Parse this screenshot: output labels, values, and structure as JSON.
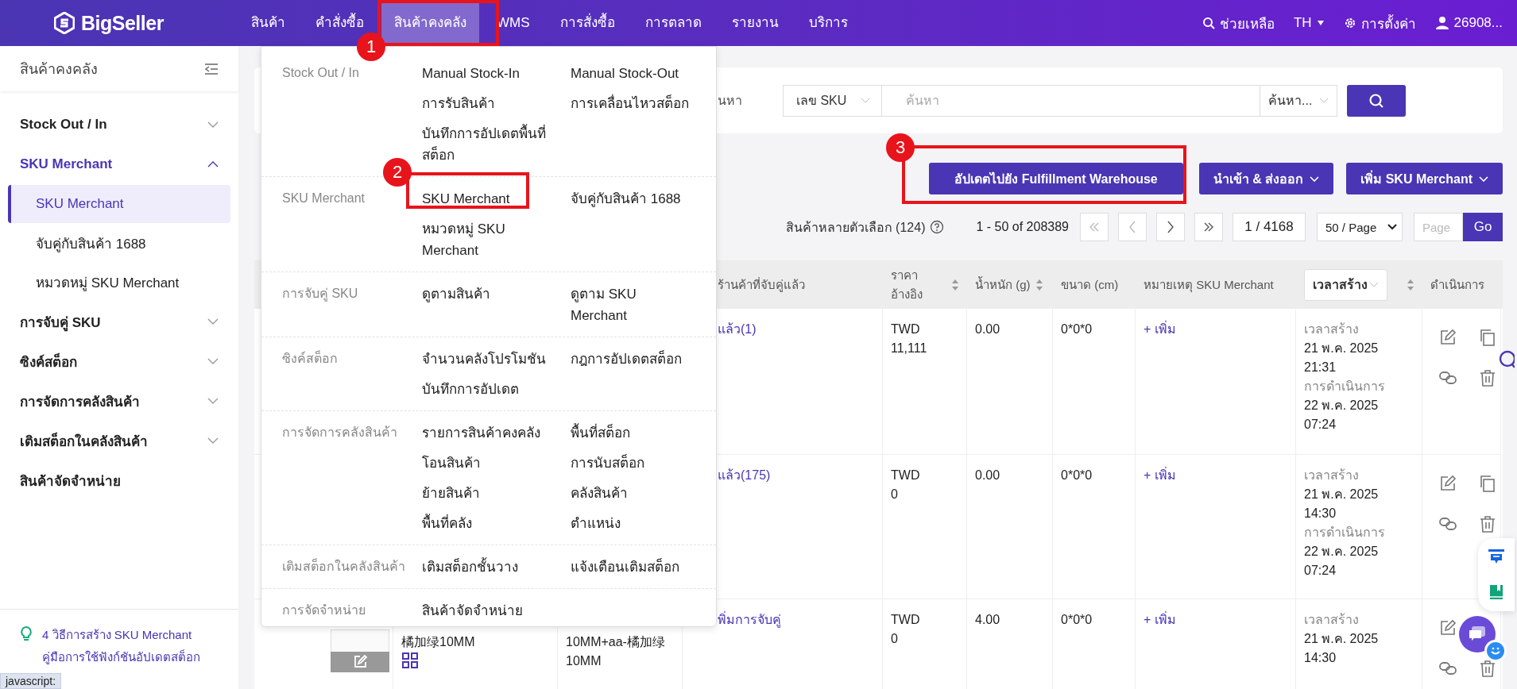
{
  "topbar": {
    "logo": "BigSeller",
    "nav": [
      {
        "label": "สินค้า",
        "selected": false
      },
      {
        "label": "คำสั่งซื้อ",
        "selected": false
      },
      {
        "label": "สินค้าคงคลัง",
        "selected": true
      },
      {
        "label": "WMS",
        "selected": false
      },
      {
        "label": "การสั่งซื้อ",
        "selected": false
      },
      {
        "label": "การตลาด",
        "selected": false
      },
      {
        "label": "รายงาน",
        "selected": false
      },
      {
        "label": "บริการ",
        "selected": false
      }
    ],
    "help": "ช่วยเหลือ",
    "language": "TH",
    "settings": "การตั้งค่า",
    "user": "26908..."
  },
  "sidebar": {
    "title": "สินค้าคงคลัง",
    "items": [
      {
        "label": "Stock Out / In",
        "expandable": true,
        "expanded": false
      },
      {
        "label": "SKU Merchant",
        "expandable": true,
        "expanded": true,
        "children": [
          {
            "label": "SKU Merchant",
            "selected": true
          },
          {
            "label": "จับคู่กับสินค้า 1688",
            "selected": false
          },
          {
            "label": "หมวดหมู่ SKU Merchant",
            "selected": false
          }
        ]
      },
      {
        "label": "การจับคู่ SKU",
        "expandable": true,
        "expanded": false
      },
      {
        "label": "ซิงค์สต็อก",
        "expandable": true,
        "expanded": false
      },
      {
        "label": "การจัดการคลังสินค้า",
        "expandable": true,
        "expanded": false
      },
      {
        "label": "เติมสต็อกในคลังสินค้า",
        "expandable": true,
        "expanded": false
      },
      {
        "label": "สินค้าจัดจำหน่าย",
        "expandable": false,
        "expanded": false
      }
    ],
    "tips": [
      "4 วิธีการสร้าง SKU Merchant",
      "คู่มือการใช้ฟังก์ชันอัปเดตสต็อก"
    ]
  },
  "dropdown": {
    "sections": [
      {
        "label": "Stock Out / In",
        "items": [
          "Manual Stock-In",
          "Manual Stock-Out",
          "การรับสินค้า",
          "การเคลื่อนไหวสต็อก",
          "บันทึกการอัปเดตพื้นที่สต็อก"
        ]
      },
      {
        "label": "SKU Merchant",
        "items": [
          "SKU Merchant",
          "จับคู่กับสินค้า 1688",
          "หมวดหมู่ SKU Merchant"
        ]
      },
      {
        "label": "การจับคู่ SKU",
        "items": [
          "ดูตามสินค้า",
          "ดูตาม SKU Merchant"
        ]
      },
      {
        "label": "ซิงค์สต็อก",
        "items": [
          "จำนวนคลังโปรโมชัน",
          "กฎการอัปเดตสต็อก",
          "บันทึกการอัปเดต"
        ]
      },
      {
        "label": "การจัดการคลังสินค้า",
        "items": [
          "รายการสินค้าคงคลัง",
          "พื้นที่สต็อก",
          "โอนสินค้า",
          "การนับสต็อก",
          "ย้ายสินค้า",
          "คลังสินค้า",
          "พื้นที่คลัง",
          "ตำแหน่ง"
        ]
      },
      {
        "label": "เติมสต็อกในคลังสินค้า",
        "items": [
          "เติมสต็อกชั้นวาง",
          "แจ้งเตือนเติมสต็อก"
        ]
      },
      {
        "label": "การจัดจำหน่าย",
        "items": [
          "สินค้าจัดจำหน่าย"
        ]
      }
    ]
  },
  "search": {
    "label": "นหา",
    "field_type": "เลข SKU",
    "placeholder": "ค้นหา",
    "mode": "ค้นหา..."
  },
  "actions": [
    {
      "label": "อัปเดตไปยัง Fulfillment Warehouse",
      "dropdown": false
    },
    {
      "label": "นำเข้า & ส่งออก",
      "dropdown": true
    },
    {
      "label": "เพิ่ม SKU Merchant",
      "dropdown": true
    }
  ],
  "pagination": {
    "variants": "สินค้าหลายตัวเลือก (124)",
    "range": "1 - 50 of 208389",
    "page": "1 / 4168",
    "page_size": "50 / Page",
    "page_placeholder": "Page",
    "go": "Go"
  },
  "table": {
    "columns": [
      {
        "kind": "store",
        "label": "ร้านค้าที่จับคู่แล้ว",
        "sortable": false
      },
      {
        "kind": "price",
        "label": "ราคา\nอ้างอิง",
        "sortable": true
      },
      {
        "kind": "weight",
        "label": "น้ำหนัก (g)",
        "sortable": true
      },
      {
        "kind": "size",
        "label": "ขนาด (cm)",
        "sortable": false
      },
      {
        "kind": "note",
        "label": "หมายเหตุ SKU Merchant",
        "sortable": false
      },
      {
        "kind": "time",
        "label": "เวลาสร้าง",
        "sortable": true
      },
      {
        "kind": "actions",
        "label": "ดำเนินการ",
        "sortable": false
      }
    ],
    "rows": [
      {
        "store": "แล้ว(1)",
        "currency": "TWD",
        "price": "11,111",
        "weight": "0.00",
        "size": "0*0*0",
        "note": "+ เพิ่ม",
        "times": [
          "เวลาสร้าง",
          "21 พ.ค. 2025",
          "21:31",
          "การดำเนินการ",
          "22 พ.ค. 2025",
          "07:24"
        ],
        "actions": [
          {
            "kind": "edit"
          },
          {
            "kind": "copy"
          },
          {
            "kind": "link"
          },
          {
            "kind": "delete"
          }
        ]
      },
      {
        "store": "แล้ว(175)",
        "currency": "TWD",
        "price": "0",
        "weight": "0.00",
        "size": "0*0*0",
        "note": "+ เพิ่ม",
        "times": [
          "เวลาสร้าง",
          "21 พ.ค. 2025",
          "14:30",
          "การดำเนินการ",
          "22 พ.ค. 2025",
          "07:24"
        ],
        "actions": [
          {
            "kind": "edit"
          },
          {
            "kind": "copy"
          },
          {
            "kind": "link"
          },
          {
            "kind": "delete"
          }
        ]
      },
      {
        "image": {
          "kind": "placeholder"
        },
        "name": "橘加绿10MM",
        "sku": "10MM+aa-橘加绿10MM",
        "store": "พิ่มการจับคู่",
        "currency": "TWD",
        "price": "0",
        "weight": "4.00",
        "size": "0*0*0",
        "note": "+ เพิ่ม",
        "times": [
          "เวลาสร้าง",
          "21 พ.ค. 2025",
          "14:30"
        ],
        "actions": [
          {
            "kind": "edit"
          },
          {
            "kind": "link"
          },
          {
            "kind": "delete"
          }
        ]
      }
    ]
  },
  "annotations": [
    "1",
    "2",
    "3"
  ],
  "status_bar": "javascript:"
}
